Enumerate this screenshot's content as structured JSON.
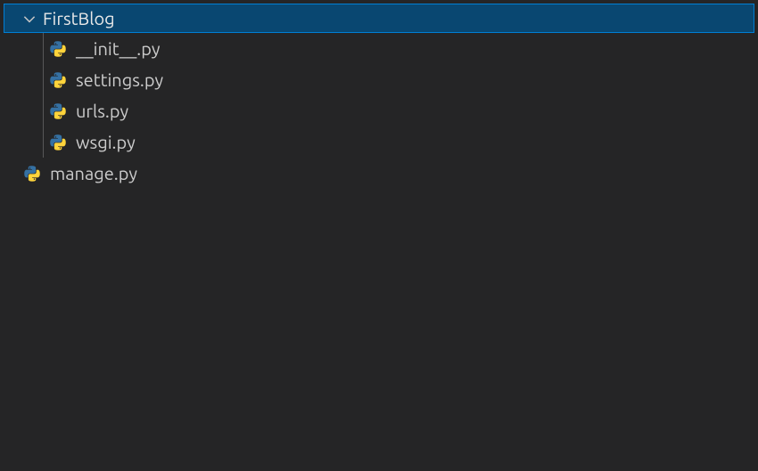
{
  "explorer": {
    "folder": {
      "name": "FirstBlog",
      "expanded": true,
      "children": [
        {
          "name": "__init__.py",
          "type": "python"
        },
        {
          "name": "settings.py",
          "type": "python"
        },
        {
          "name": "urls.py",
          "type": "python"
        },
        {
          "name": "wsgi.py",
          "type": "python"
        }
      ]
    },
    "rootFiles": [
      {
        "name": "manage.py",
        "type": "python"
      }
    ]
  },
  "colors": {
    "background": "#252526",
    "selectionBackground": "#094771",
    "selectionBorder": "#007fd4",
    "text": "#cccccc",
    "pythonIconBg": "#3571a3",
    "pythonIconFg": "#ffd43b"
  }
}
